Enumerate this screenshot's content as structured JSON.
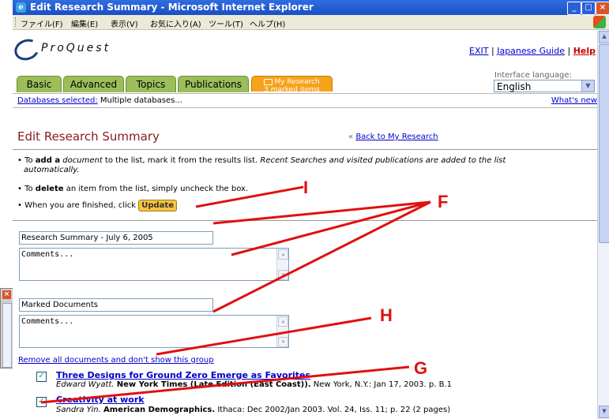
{
  "window": {
    "title": "Edit Research Summary - Microsoft Internet Explorer",
    "menu": [
      "ファイル(F)",
      "編集(E)",
      "表示(V)",
      "お気に入り(A)",
      "ツール(T)",
      "ヘルプ(H)"
    ]
  },
  "header": {
    "logo_text": "ProQuest",
    "links": {
      "exit": "EXIT",
      "separator": "|",
      "japanese_guide": "Japanese Guide",
      "help": "Help"
    },
    "tabs": [
      "Basic",
      "Advanced",
      "Topics",
      "Publications"
    ],
    "my_research": {
      "label": "My Research",
      "sub": "3 marked items"
    },
    "language_label": "Interface language:",
    "language_value": "English"
  },
  "dbbar": {
    "label": "Databases selected:",
    "value": " Multiple databases...",
    "whats_new": "What's new"
  },
  "main": {
    "title": "Edit Research Summary",
    "back_prefix": "«",
    "back_link": "Back to My Research",
    "instructions": {
      "add_prefix": "• To ",
      "add_bold": "add a",
      "add_italic_doc": "document",
      "add_mid": " to the list, mark it from the results list. ",
      "add_italic_tail": "Recent Searches and visited publications are added to the list",
      "add_italic_tail2": "automatically.",
      "delete_prefix": "• To ",
      "delete_bold": "delete",
      "delete_rest": " an item from the list, simply uncheck the box.",
      "finish": "• When you are finished, click",
      "update_button": "Update"
    },
    "summary_title_value": "Research Summary -  July 6, 2005",
    "comments_placeholder": "Comments...",
    "marked_docs_value": "Marked Documents",
    "remove_link": "Remove all documents and don't show this group",
    "documents": [
      {
        "checked": true,
        "title": "Three Designs for Ground Zero Emerge as Favorites",
        "author": "Edward Wyatt.",
        "source": "New York Times (Late Edition (East Coast)).",
        "details": " New York, N.Y.: Jan 17, 2003. p. B.1"
      },
      {
        "checked": true,
        "title": "Creativity at work",
        "author": "Sandra Yin.",
        "source": "American Demographics.",
        "details": " Ithaca: Dec 2002/Jan 2003. Vol. 24, Iss. 11; p. 22 (2 pages)"
      }
    ]
  },
  "annotations": [
    "I",
    "F",
    "H",
    "G"
  ],
  "colors": {
    "annotation": "#e01010",
    "title_bar": "#1a4fc4",
    "tab_green": "#9bbd5a",
    "tab_orange": "#f7a21b",
    "page_title": "#8b1a1a",
    "link": "#0000cc"
  }
}
